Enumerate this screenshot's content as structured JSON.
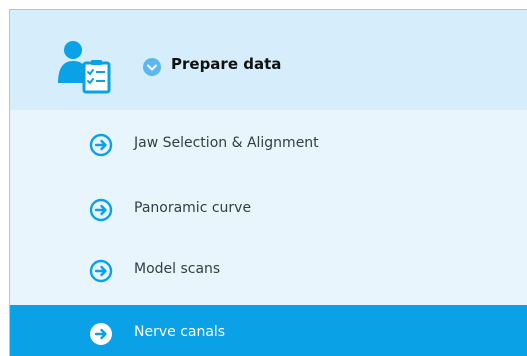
{
  "header": {
    "title": "Prepare data",
    "icon": "user-checklist-icon",
    "chevron_icon": "chevron-down-icon"
  },
  "steps": [
    {
      "label": "Jaw Selection & Alignment",
      "icon": "arrow-circle-right-icon",
      "active": false
    },
    {
      "label": "Panoramic curve",
      "icon": "arrow-circle-right-icon",
      "active": false
    },
    {
      "label": "Model scans",
      "icon": "arrow-circle-right-icon",
      "active": false
    },
    {
      "label": "Nerve canals",
      "icon": "arrow-circle-right-icon",
      "active": true
    }
  ],
  "colors": {
    "accent": "#0aa1e6",
    "header_bg": "#d6edfb",
    "panel_bg": "#e8f5fd",
    "text": "#333d45"
  }
}
